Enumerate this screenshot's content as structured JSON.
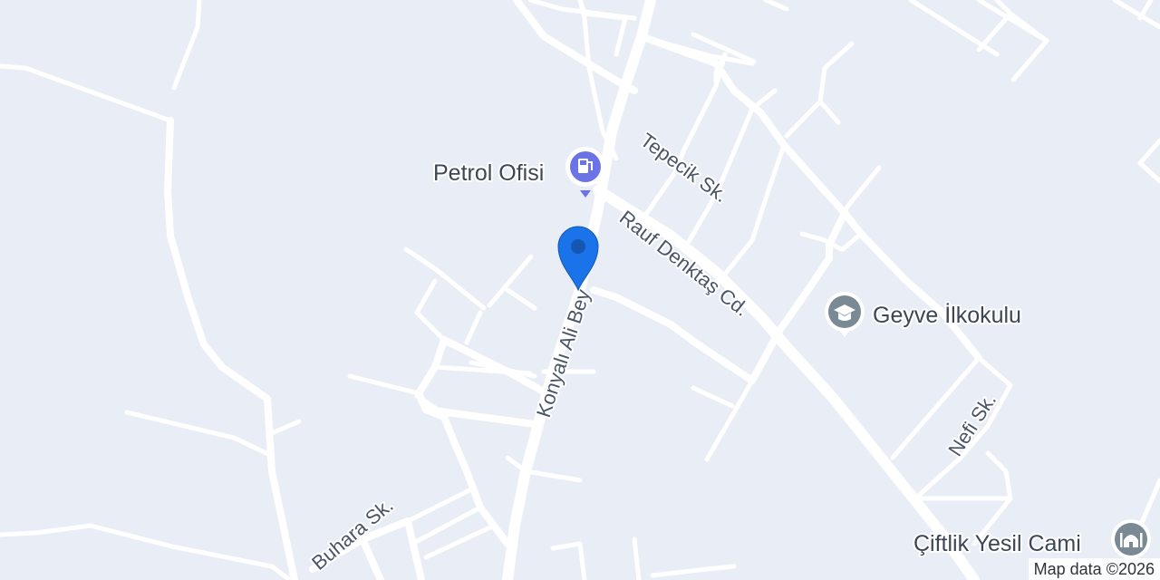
{
  "streets": {
    "konyali_ali_bey": "Konyalı Ali Bey",
    "tepecik": "Tepecik Sk.",
    "rauf_denktas": "Rauf Denktaş Cd.",
    "nefi": "Nefi Sk.",
    "buhara": "Buhara Sk."
  },
  "pois": {
    "petrol_ofisi": {
      "name": "Petrol Ofisi",
      "icon": "gas-station-icon",
      "color": "#6b74e6"
    },
    "geyve_ilkokulu": {
      "name": "Geyve İlkokulu",
      "icon": "school-icon",
      "color": "#7a8a94"
    },
    "ciftlik_yesil_cami": {
      "name": "Çiftlik Yesil Cami",
      "icon": "mosque-icon",
      "color": "#7a8a94"
    }
  },
  "marker": {
    "icon": "location-pin-icon",
    "color": "#1a73e8"
  },
  "attribution": "Map data ©2026",
  "colors": {
    "background": "#e9edf5",
    "road": "#ffffff"
  }
}
